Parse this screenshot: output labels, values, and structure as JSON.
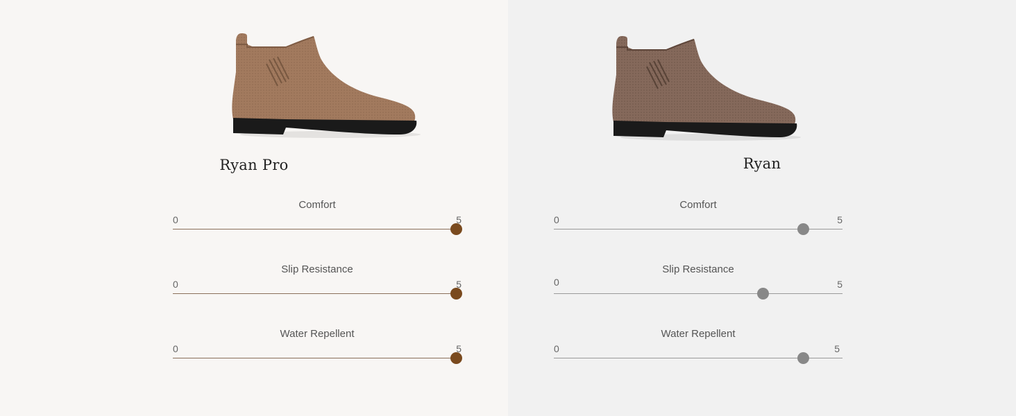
{
  "products": [
    {
      "name": "Ryan Pro",
      "shoe_icon": "chelsea-boot-icon",
      "accent": "#7a4a1e",
      "metrics": [
        {
          "label": "Comfort",
          "min": "0",
          "max": "5",
          "value": 5
        },
        {
          "label": "Slip Resistance",
          "min": "0",
          "max": "5",
          "value": 5
        },
        {
          "label": "Water Repellent",
          "min": "0",
          "max": "5",
          "value": 5
        }
      ]
    },
    {
      "name": "Ryan",
      "shoe_icon": "chelsea-boot-icon",
      "accent": "#888888",
      "metrics": [
        {
          "label": "Comfort",
          "min": "0",
          "max": "5",
          "value": 4.4
        },
        {
          "label": "Slip Resistance",
          "min": "0",
          "max": "5",
          "value": 3.7
        },
        {
          "label": "Water Repellent",
          "min": "0",
          "max": "5",
          "value": 4.4
        }
      ]
    }
  ]
}
